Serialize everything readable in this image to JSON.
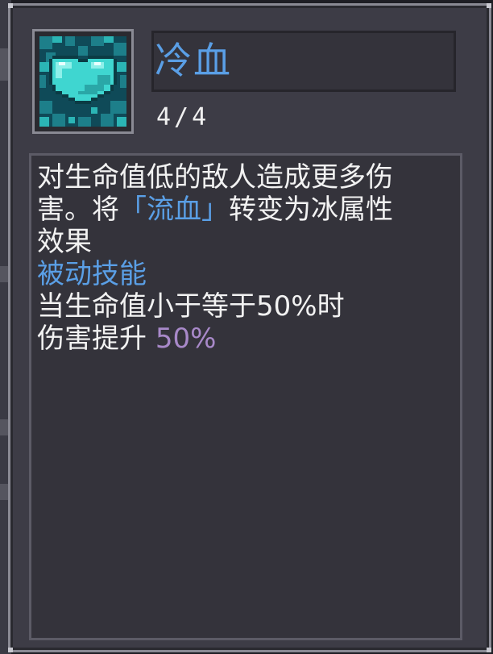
{
  "skill": {
    "name": "冷血",
    "level": "4/4",
    "icon": "ice-heart-icon"
  },
  "description": {
    "line1": "对生命值低的敌人造成更多伤",
    "line2_prefix": "害。将",
    "line2_keyword": "「流血」",
    "line2_suffix": "转变为冰属性",
    "line3": "效果",
    "type_label": "被动技能",
    "condition": "当生命值小于等于50%时",
    "bonus_label": "伤害提升",
    "bonus_value": "50%"
  },
  "colors": {
    "name": "#5a9fe6",
    "keyword": "#5a9fe6",
    "type_label": "#5a9fe6",
    "bonus_value": "#a889c9",
    "text": "#f2f2f2",
    "panel": "#3d3c46",
    "icon_main": "#3fd6d0"
  }
}
